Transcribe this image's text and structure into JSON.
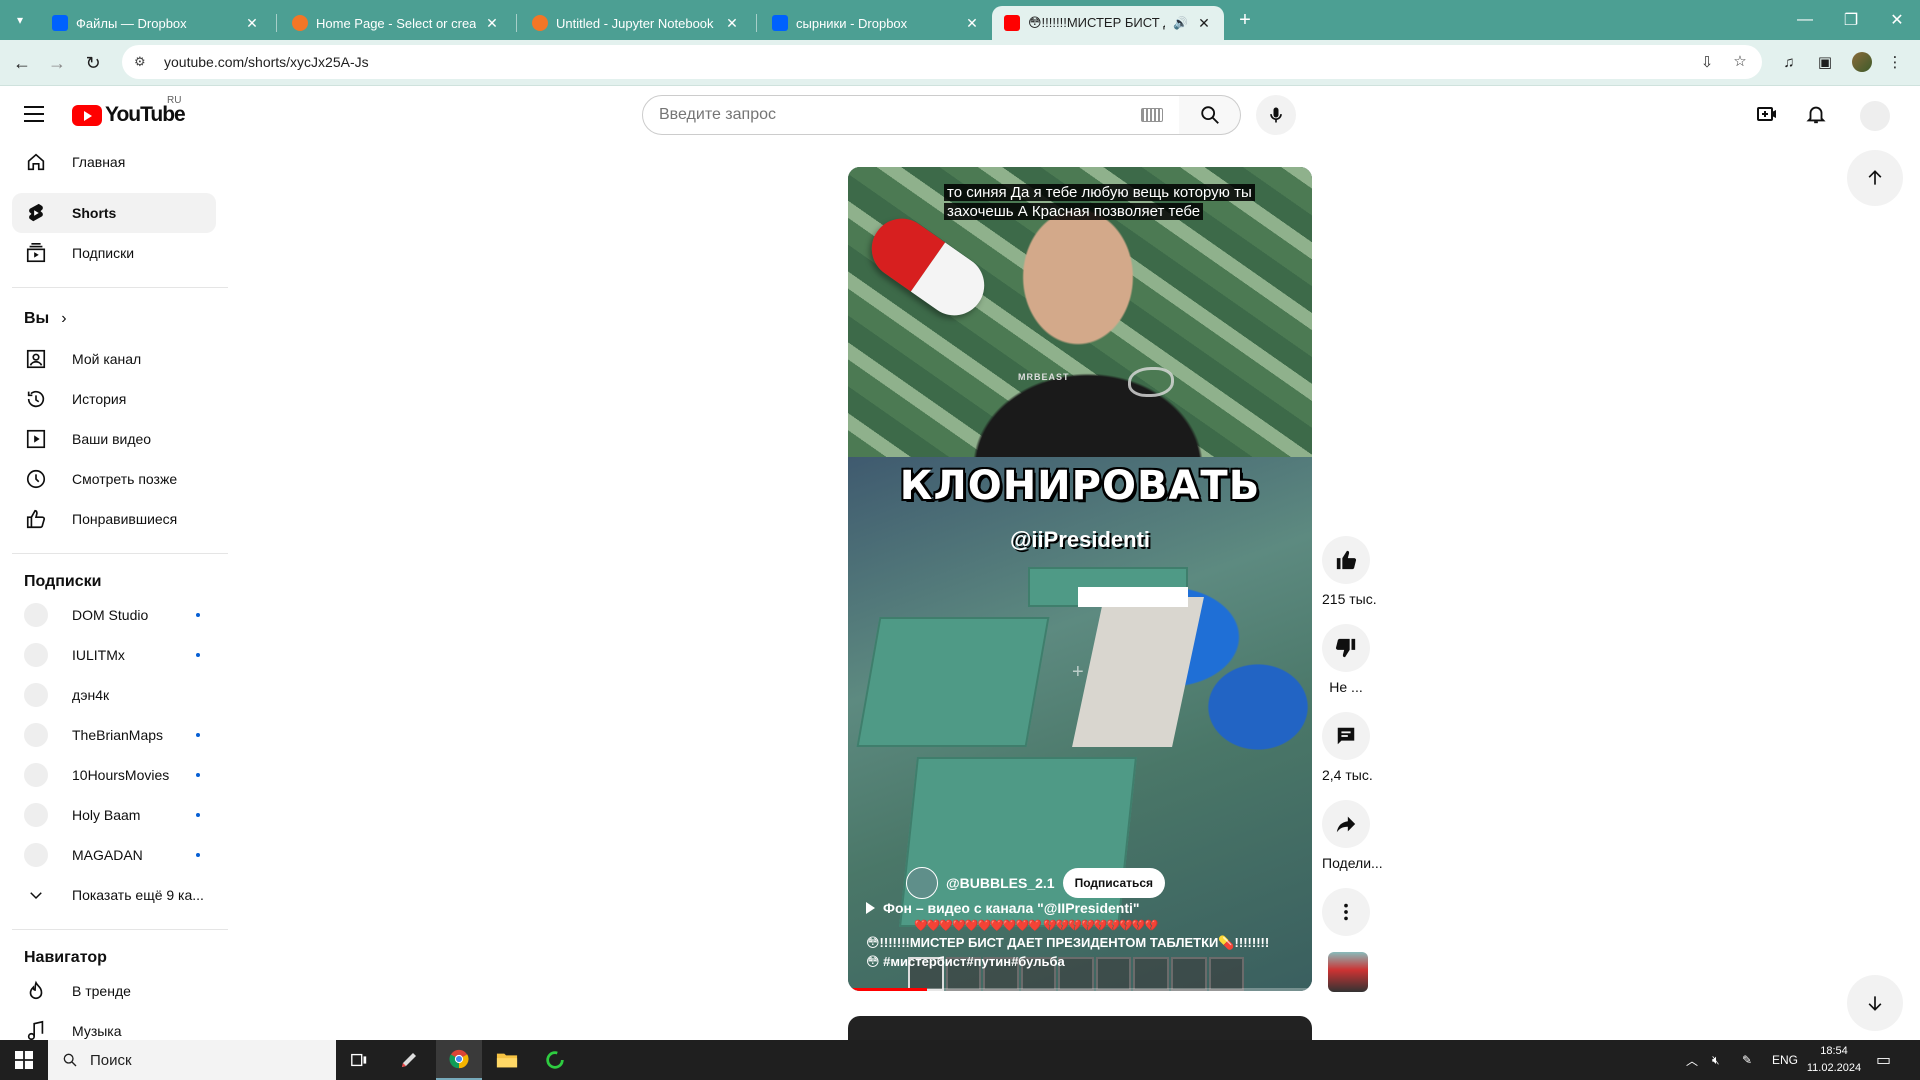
{
  "browser": {
    "tabs": [
      {
        "title": "Файлы — Dropbox",
        "icon": "dropbox-icon"
      },
      {
        "title": "Home Page - Select or create a",
        "icon": "jupyter-icon"
      },
      {
        "title": "Untitled - Jupyter Notebook",
        "icon": "jupyter-icon"
      },
      {
        "title": "сырники - Dropbox",
        "icon": "dropbox-icon"
      },
      {
        "title": "😳!!!!!!!МИСТЕР БИСТ ДАЕ",
        "icon": "youtube-icon"
      }
    ],
    "active_tab_index": 4,
    "url": "youtube.com/shorts/xycJx25A-Js",
    "accent_color": "#4c9f93"
  },
  "youtube": {
    "logo_text": "YouTube",
    "region": "RU",
    "search_placeholder": "Введите запрос"
  },
  "sidebar": {
    "main": [
      {
        "label": "Главная",
        "icon": "home-icon"
      },
      {
        "label": "Shorts",
        "icon": "shorts-icon"
      },
      {
        "label": "Подписки",
        "icon": "subscriptions-icon"
      }
    ],
    "you_heading": "Вы",
    "you": [
      {
        "label": "Мой канал",
        "icon": "channel-icon"
      },
      {
        "label": "История",
        "icon": "history-icon"
      },
      {
        "label": "Ваши видео",
        "icon": "your-videos-icon"
      },
      {
        "label": "Смотреть позже",
        "icon": "watch-later-icon"
      },
      {
        "label": "Понравившиеся",
        "icon": "liked-icon"
      }
    ],
    "subs_heading": "Подписки",
    "subscriptions": [
      {
        "name": "DOM Studio",
        "new": true
      },
      {
        "name": "IULITMx",
        "new": true
      },
      {
        "name": "дэн4к",
        "new": false
      },
      {
        "name": "TheBrianMaps",
        "new": true
      },
      {
        "name": "10HoursMovies",
        "new": true
      },
      {
        "name": "Holy Baam",
        "new": true
      },
      {
        "name": "MAGADAN",
        "new": true
      }
    ],
    "show_more": "Показать ещё 9 ка...",
    "nav_heading": "Навигатор",
    "navigator": [
      {
        "label": "В тренде",
        "icon": "trending-icon"
      },
      {
        "label": "Музыка",
        "icon": "music-icon"
      }
    ]
  },
  "short": {
    "caption": "то синяя Да я тебе любую вещь которую ты захочешь А Красная позволяет тебе",
    "overlay_title": "КЛОНИРОВАТЬ",
    "overlay_handle": "@iiPresidenti",
    "shirt_text": "MRBEAST",
    "channel": "@BUBBLES_2.1",
    "subscribe_label": "Подписаться",
    "background_credit": "Фон – видео с канала \"@IIPresidenti\"",
    "hearts": "❤️❤️❤️❤️❤️❤️❤️❤️❤️❤️ 💔💔💔💔💔💔💔💔💔",
    "title_line1": "😳!!!!!!!МИСТЕР БИСТ ДАЕТ ПРЕЗИДЕНТОМ ТАБЛЕТКИ💊!!!!!!!!",
    "title_line2": "😳 #мистербист#путин#бульба",
    "progress": 0.17
  },
  "actions": {
    "likes": "215 тыс.",
    "dislike": "Не ...",
    "comments": "2,4 тыс.",
    "share": "Подели..."
  },
  "taskbar": {
    "search_label": "Поиск",
    "lang": "ENG",
    "time": "18:54",
    "date": "11.02.2024"
  }
}
